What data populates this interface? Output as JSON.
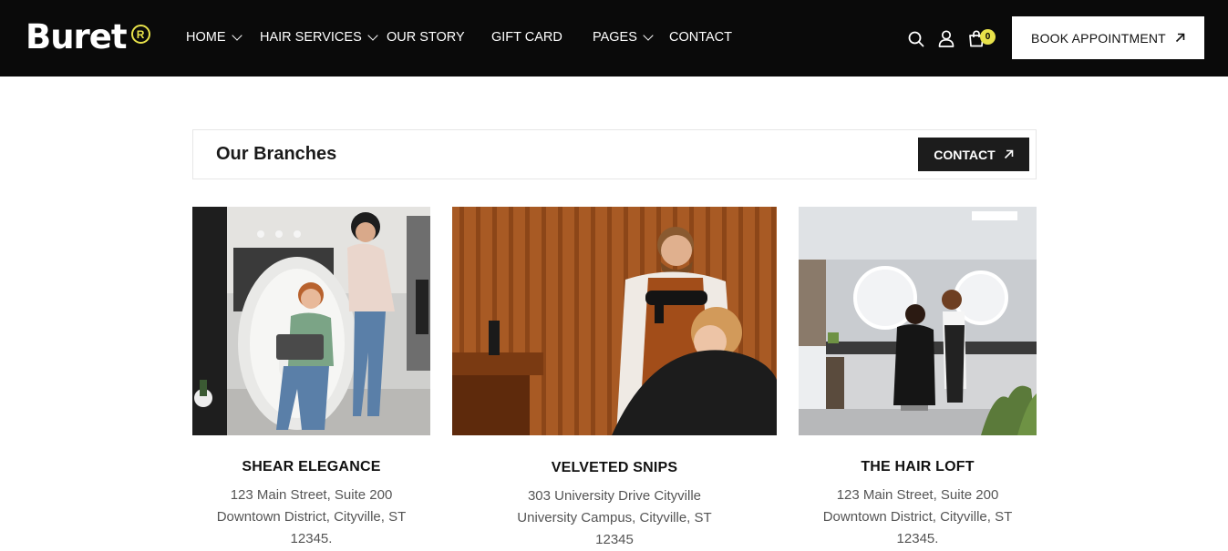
{
  "header": {
    "logo_text": "Buret",
    "logo_mark": "R",
    "nav": [
      {
        "label": "HOME",
        "has_dropdown": true
      },
      {
        "label": "HAIR SERVICES",
        "has_dropdown": true
      },
      {
        "label": "OUR STORY",
        "has_dropdown": false
      },
      {
        "label": "GIFT CARD",
        "has_dropdown": false
      },
      {
        "label": "PAGES",
        "has_dropdown": true
      },
      {
        "label": "CONTACT",
        "has_dropdown": false
      }
    ],
    "icons": [
      "search-icon",
      "user-icon",
      "cart-icon"
    ],
    "cart_count": "0",
    "book_label": "BOOK APPOINTMENT"
  },
  "branches": {
    "title": "Our Branches",
    "contact_label": "CONTACT",
    "items": [
      {
        "name": "SHEAR ELEGANCE",
        "address": [
          "123 Main Street, Suite 200",
          "Downtown District, Cityville, ST",
          "12345."
        ]
      },
      {
        "name": "VELVETED SNIPS",
        "address": [
          "303 University Drive Cityville",
          "University Campus, Cityville, ST",
          "12345"
        ]
      },
      {
        "name": "THE HAIR LOFT",
        "address": [
          "123 Main Street, Suite 200",
          "Downtown District, Cityville, ST",
          "12345."
        ]
      }
    ]
  },
  "colors": {
    "header_bg": "#0a0a0a",
    "accent": "#e8e24a",
    "dark_button": "#1c1c1c"
  }
}
